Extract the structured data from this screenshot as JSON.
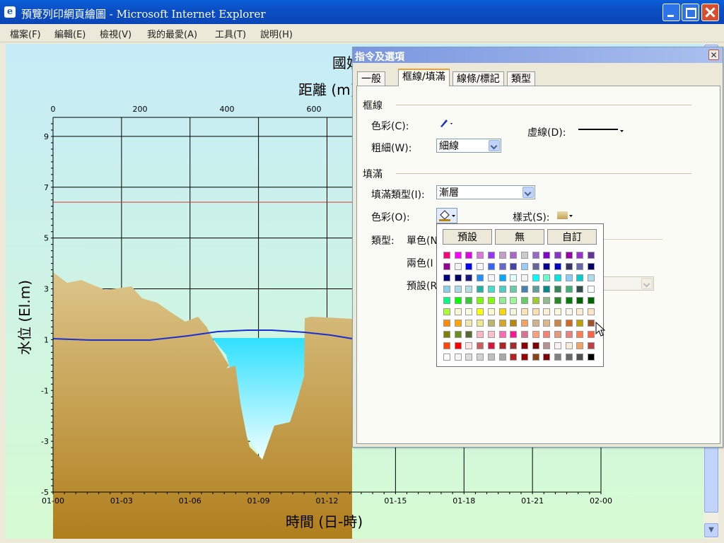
{
  "window": {
    "title": "預覽列印網頁繪圖 - Microsoft Internet Explorer",
    "app_icon": "ie-icon"
  },
  "menu": [
    {
      "label": "檔案(F)",
      "x": 14
    },
    {
      "label": "編輯(E)",
      "x": 77
    },
    {
      "label": "檢視(V)",
      "x": 141
    },
    {
      "label": "我的最愛(A)",
      "x": 208
    },
    {
      "label": "工具(T)",
      "x": 304
    },
    {
      "label": "說明(H)",
      "x": 368
    }
  ],
  "chart": {
    "title_partial": "國妨",
    "top_axis_label": "距離 (m)",
    "top_ticks": [
      "0",
      "200",
      "400",
      "600"
    ],
    "ylabel": "水位 (El.m)",
    "xlabel": "時間 (日-時)",
    "yticks": [
      "9",
      "7",
      "5",
      "3",
      "1",
      "-1",
      "-3",
      "-5"
    ],
    "xticks": [
      "01-00",
      "01-03",
      "01-06",
      "01-09",
      "01-12",
      "01-15",
      "01-18",
      "01-21",
      "02-00"
    ],
    "colors": {
      "water_line": "#1a2fd0",
      "ref_line": "#e03030",
      "water_fill": "#30e0ff",
      "ground_top": "#dcc58a",
      "ground_bottom": "#b07e1c"
    }
  },
  "chart_data": {
    "type": "line",
    "title": "國妨",
    "xlabel": "時間 (日-時)",
    "ylabel": "水位 (El.m)",
    "x2label": "距離 (m)",
    "x2_ticks": [
      0,
      200,
      400,
      600
    ],
    "x_ticks": [
      "01-00",
      "01-03",
      "01-06",
      "01-09",
      "01-12",
      "01-15",
      "01-18",
      "01-21",
      "02-00"
    ],
    "ylim": [
      -5,
      10
    ],
    "series": [
      {
        "x": [
          "01-00",
          "01-03",
          "01-06",
          "01-09",
          "01-12",
          "01-13"
        ],
        "values": [
          1.2,
          1.1,
          1.2,
          1.4,
          1.3,
          1.2
        ]
      }
    ],
    "reference_line": 6.7,
    "cross_section_ground_el": [
      3.8,
      3.4,
      3.5,
      3.1,
      3.2,
      2.7,
      2.5,
      2.1,
      1.3,
      0.1,
      -2.8,
      -3.7,
      -1.4,
      2.1,
      2.0
    ]
  },
  "dialog": {
    "title": "指令及選項",
    "tabs": [
      "一般",
      "框線/填滿",
      "線條/標記",
      "類型"
    ],
    "active_tab": 1,
    "border_group": "框線",
    "color_label": "色彩(C):",
    "dash_label": "虛線(D):",
    "weight_label": "粗細(W):",
    "weight_value": "細線",
    "fill_group": "填滿",
    "fill_type_label": "填滿類型(I):",
    "fill_type_value": "漸層",
    "fill_color_label": "色彩(O):",
    "style_label": "樣式(S):",
    "type_label": "類型:",
    "mono_label": "單色(N",
    "dual_label": "兩色(I",
    "preset_label": "預設(R"
  },
  "palette": {
    "buttons": [
      "預設",
      "無",
      "自訂"
    ],
    "rows": [
      [
        "#ff007f",
        "#ff00ff",
        "#e600e6",
        "#dd77dd",
        "#9933ff",
        "#cc99cc",
        "#aa66cc",
        "#cccccc",
        "#9966cc",
        "#8800cc",
        "#8833cc",
        "#9900aa",
        "#9933cc",
        "#663399"
      ],
      [
        "#990099",
        "#f2f2f2",
        "#0000ff",
        "#f5f5ff",
        "#3366ff",
        "#6666cc",
        "#4444aa",
        "#99ccff",
        "#666699",
        "#000099",
        "#0000cc",
        "#333366",
        "#6666aa",
        "#000066"
      ],
      [
        "#000080",
        "#000066",
        "#1a1a80",
        "#1e90ff",
        "#f0f8ff",
        "#00aaff",
        "#e0ffff",
        "#f5f5f5",
        "#00ffff",
        "#66ffcc",
        "#00e5e5",
        "#87cefa",
        "#00ced1",
        "#aaddee"
      ],
      [
        "#87ceeb",
        "#aad8e6",
        "#b0e0e6",
        "#20b2aa",
        "#40e0d0",
        "#48d1cc",
        "#66cdaa",
        "#4682b4",
        "#5f9ea0",
        "#008b8b",
        "#2e8b57",
        "#3cb371",
        "#2f4f4f",
        "#f5fffa"
      ],
      [
        "#00ff7f",
        "#00ff00",
        "#32cd32",
        "#7cfc00",
        "#7fff00",
        "#90ee90",
        "#98fb98",
        "#66cc66",
        "#9acd32",
        "#8fbc8f",
        "#228b22",
        "#008000",
        "#006400",
        "#006600"
      ],
      [
        "#adff2f",
        "#fafad2",
        "#ffffe0",
        "#ffff00",
        "#fffacd",
        "#ffd700",
        "#f5f5dc",
        "#ffe4b5",
        "#ffdead",
        "#ffefd5",
        "#fff8dc",
        "#fdf5e6",
        "#ffebcd",
        "#ffe4c4"
      ],
      [
        "#ff8c00",
        "#ffa500",
        "#eee8aa",
        "#f0e68c",
        "#bdb76b",
        "#daa520",
        "#b8860b",
        "#f4a460",
        "#d2b48c",
        "#deb887",
        "#cd853f",
        "#d2691e",
        "#c0a000",
        "#a0522d"
      ],
      [
        "#808000",
        "#6b8e23",
        "#556b2f",
        "#ffb6c1",
        "#ffc0cb",
        "#ff69b4",
        "#ff1493",
        "#db7093",
        "#ffa07a",
        "#fa8072",
        "#e9967a",
        "#f08080",
        "#ff7f50",
        "#ff6347"
      ],
      [
        "#ff4500",
        "#ff0000",
        "#ffe4e1",
        "#cd5c5c",
        "#dc143c",
        "#b22222",
        "#a52a2a",
        "#8b0000",
        "#800000",
        "#bc8f8f",
        "#fff0f5",
        "#faebd7",
        "#f4a460",
        "#c04040"
      ],
      [
        "#ffffff",
        "#f5f5f5",
        "#dcdcdc",
        "#d3d3d3",
        "#c0c0c0",
        "#a9a9a9",
        "#b22222",
        "#990000",
        "#8b4513",
        "#800000",
        "#808080",
        "#696969",
        "#505050",
        "#000000"
      ]
    ]
  }
}
